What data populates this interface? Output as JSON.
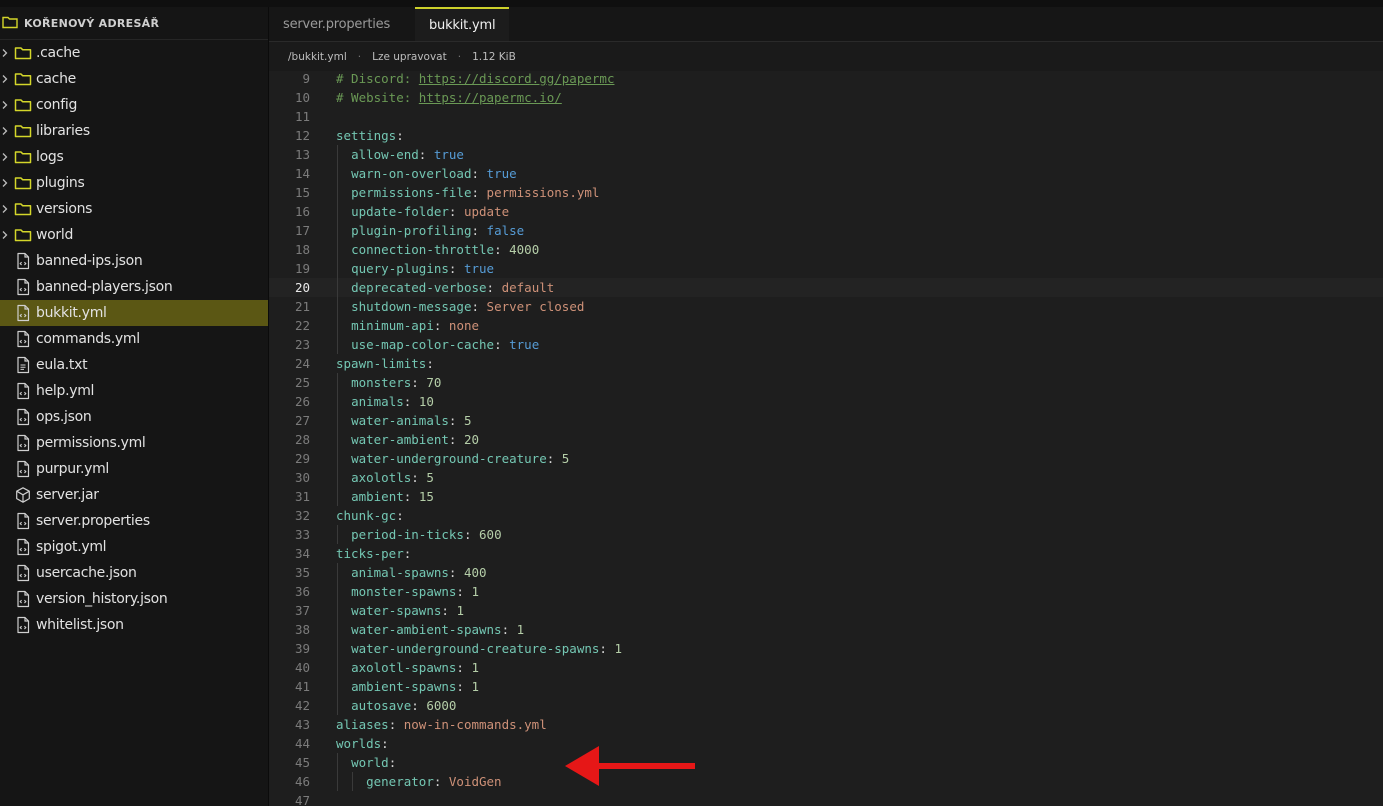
{
  "sidebar": {
    "header": "KOŘENOVÝ ADRESÁŘ",
    "items": [
      {
        "label": ".cache",
        "type": "folder"
      },
      {
        "label": "cache",
        "type": "folder"
      },
      {
        "label": "config",
        "type": "folder"
      },
      {
        "label": "libraries",
        "type": "folder"
      },
      {
        "label": "logs",
        "type": "folder"
      },
      {
        "label": "plugins",
        "type": "folder"
      },
      {
        "label": "versions",
        "type": "folder"
      },
      {
        "label": "world",
        "type": "folder"
      },
      {
        "label": "banned-ips.json",
        "type": "code-file"
      },
      {
        "label": "banned-players.json",
        "type": "code-file"
      },
      {
        "label": "bukkit.yml",
        "type": "code-file",
        "selected": true
      },
      {
        "label": "commands.yml",
        "type": "code-file"
      },
      {
        "label": "eula.txt",
        "type": "text-file"
      },
      {
        "label": "help.yml",
        "type": "code-file"
      },
      {
        "label": "ops.json",
        "type": "code-file"
      },
      {
        "label": "permissions.yml",
        "type": "code-file"
      },
      {
        "label": "purpur.yml",
        "type": "code-file"
      },
      {
        "label": "server.jar",
        "type": "package-file"
      },
      {
        "label": "server.properties",
        "type": "code-file"
      },
      {
        "label": "spigot.yml",
        "type": "code-file"
      },
      {
        "label": "usercache.json",
        "type": "code-file"
      },
      {
        "label": "version_history.json",
        "type": "code-file"
      },
      {
        "label": "whitelist.json",
        "type": "code-file"
      }
    ]
  },
  "tabs": [
    {
      "label": "server.properties",
      "active": false
    },
    {
      "label": "bukkit.yml",
      "active": true
    }
  ],
  "fileinfo": {
    "path": "/bukkit.yml",
    "mode": "Lze upravovat",
    "size": "1.12 KiB"
  },
  "editor": {
    "current_line": 20,
    "lines": [
      {
        "n": "9",
        "indent": 0,
        "parts": [
          [
            "cmt",
            "# Discord: "
          ],
          [
            "url",
            "https://discord.gg/papermc"
          ]
        ]
      },
      {
        "n": "10",
        "indent": 0,
        "parts": [
          [
            "cmt",
            "# Website: "
          ],
          [
            "url",
            "https://papermc.io/"
          ]
        ]
      },
      {
        "n": "11",
        "indent": 0,
        "parts": []
      },
      {
        "n": "12",
        "indent": 0,
        "parts": [
          [
            "key",
            "settings"
          ],
          [
            "punc",
            ":"
          ]
        ]
      },
      {
        "n": "13",
        "indent": 1,
        "parts": [
          [
            "key",
            "allow-end"
          ],
          [
            "punc",
            ": "
          ],
          [
            "bool",
            "true"
          ]
        ]
      },
      {
        "n": "14",
        "indent": 1,
        "parts": [
          [
            "key",
            "warn-on-overload"
          ],
          [
            "punc",
            ": "
          ],
          [
            "bool",
            "true"
          ]
        ]
      },
      {
        "n": "15",
        "indent": 1,
        "parts": [
          [
            "key",
            "permissions-file"
          ],
          [
            "punc",
            ": "
          ],
          [
            "str",
            "permissions.yml"
          ]
        ]
      },
      {
        "n": "16",
        "indent": 1,
        "parts": [
          [
            "key",
            "update-folder"
          ],
          [
            "punc",
            ": "
          ],
          [
            "str",
            "update"
          ]
        ]
      },
      {
        "n": "17",
        "indent": 1,
        "parts": [
          [
            "key",
            "plugin-profiling"
          ],
          [
            "punc",
            ": "
          ],
          [
            "bool",
            "false"
          ]
        ]
      },
      {
        "n": "18",
        "indent": 1,
        "parts": [
          [
            "key",
            "connection-throttle"
          ],
          [
            "punc",
            ": "
          ],
          [
            "num",
            "4000"
          ]
        ]
      },
      {
        "n": "19",
        "indent": 1,
        "parts": [
          [
            "key",
            "query-plugins"
          ],
          [
            "punc",
            ": "
          ],
          [
            "bool",
            "true"
          ]
        ]
      },
      {
        "n": "20",
        "indent": 1,
        "parts": [
          [
            "key",
            "deprecated-verbose"
          ],
          [
            "punc",
            ": "
          ],
          [
            "str",
            "default"
          ]
        ]
      },
      {
        "n": "21",
        "indent": 1,
        "parts": [
          [
            "key",
            "shutdown-message"
          ],
          [
            "punc",
            ": "
          ],
          [
            "str",
            "Server closed"
          ]
        ]
      },
      {
        "n": "22",
        "indent": 1,
        "parts": [
          [
            "key",
            "minimum-api"
          ],
          [
            "punc",
            ": "
          ],
          [
            "str",
            "none"
          ]
        ]
      },
      {
        "n": "23",
        "indent": 1,
        "parts": [
          [
            "key",
            "use-map-color-cache"
          ],
          [
            "punc",
            ": "
          ],
          [
            "bool",
            "true"
          ]
        ]
      },
      {
        "n": "24",
        "indent": 0,
        "parts": [
          [
            "key",
            "spawn-limits"
          ],
          [
            "punc",
            ":"
          ]
        ]
      },
      {
        "n": "25",
        "indent": 1,
        "parts": [
          [
            "key",
            "monsters"
          ],
          [
            "punc",
            ": "
          ],
          [
            "num",
            "70"
          ]
        ]
      },
      {
        "n": "26",
        "indent": 1,
        "parts": [
          [
            "key",
            "animals"
          ],
          [
            "punc",
            ": "
          ],
          [
            "num",
            "10"
          ]
        ]
      },
      {
        "n": "27",
        "indent": 1,
        "parts": [
          [
            "key",
            "water-animals"
          ],
          [
            "punc",
            ": "
          ],
          [
            "num",
            "5"
          ]
        ]
      },
      {
        "n": "28",
        "indent": 1,
        "parts": [
          [
            "key",
            "water-ambient"
          ],
          [
            "punc",
            ": "
          ],
          [
            "num",
            "20"
          ]
        ]
      },
      {
        "n": "29",
        "indent": 1,
        "parts": [
          [
            "key",
            "water-underground-creature"
          ],
          [
            "punc",
            ": "
          ],
          [
            "num",
            "5"
          ]
        ]
      },
      {
        "n": "30",
        "indent": 1,
        "parts": [
          [
            "key",
            "axolotls"
          ],
          [
            "punc",
            ": "
          ],
          [
            "num",
            "5"
          ]
        ]
      },
      {
        "n": "31",
        "indent": 1,
        "parts": [
          [
            "key",
            "ambient"
          ],
          [
            "punc",
            ": "
          ],
          [
            "num",
            "15"
          ]
        ]
      },
      {
        "n": "32",
        "indent": 0,
        "parts": [
          [
            "key",
            "chunk-gc"
          ],
          [
            "punc",
            ":"
          ]
        ]
      },
      {
        "n": "33",
        "indent": 1,
        "parts": [
          [
            "key",
            "period-in-ticks"
          ],
          [
            "punc",
            ": "
          ],
          [
            "num",
            "600"
          ]
        ]
      },
      {
        "n": "34",
        "indent": 0,
        "parts": [
          [
            "key",
            "ticks-per"
          ],
          [
            "punc",
            ":"
          ]
        ]
      },
      {
        "n": "35",
        "indent": 1,
        "parts": [
          [
            "key",
            "animal-spawns"
          ],
          [
            "punc",
            ": "
          ],
          [
            "num",
            "400"
          ]
        ]
      },
      {
        "n": "36",
        "indent": 1,
        "parts": [
          [
            "key",
            "monster-spawns"
          ],
          [
            "punc",
            ": "
          ],
          [
            "num",
            "1"
          ]
        ]
      },
      {
        "n": "37",
        "indent": 1,
        "parts": [
          [
            "key",
            "water-spawns"
          ],
          [
            "punc",
            ": "
          ],
          [
            "num",
            "1"
          ]
        ]
      },
      {
        "n": "38",
        "indent": 1,
        "parts": [
          [
            "key",
            "water-ambient-spawns"
          ],
          [
            "punc",
            ": "
          ],
          [
            "num",
            "1"
          ]
        ]
      },
      {
        "n": "39",
        "indent": 1,
        "parts": [
          [
            "key",
            "water-underground-creature-spawns"
          ],
          [
            "punc",
            ": "
          ],
          [
            "num",
            "1"
          ]
        ]
      },
      {
        "n": "40",
        "indent": 1,
        "parts": [
          [
            "key",
            "axolotl-spawns"
          ],
          [
            "punc",
            ": "
          ],
          [
            "num",
            "1"
          ]
        ]
      },
      {
        "n": "41",
        "indent": 1,
        "parts": [
          [
            "key",
            "ambient-spawns"
          ],
          [
            "punc",
            ": "
          ],
          [
            "num",
            "1"
          ]
        ]
      },
      {
        "n": "42",
        "indent": 1,
        "parts": [
          [
            "key",
            "autosave"
          ],
          [
            "punc",
            ": "
          ],
          [
            "num",
            "6000"
          ]
        ]
      },
      {
        "n": "43",
        "indent": 0,
        "parts": [
          [
            "key",
            "aliases"
          ],
          [
            "punc",
            ": "
          ],
          [
            "str",
            "now-in-commands.yml"
          ]
        ]
      },
      {
        "n": "44",
        "indent": 0,
        "parts": [
          [
            "key",
            "worlds"
          ],
          [
            "punc",
            ":"
          ]
        ]
      },
      {
        "n": "45",
        "indent": 1,
        "parts": [
          [
            "key",
            "world"
          ],
          [
            "punc",
            ":"
          ]
        ]
      },
      {
        "n": "46",
        "indent": 2,
        "parts": [
          [
            "key",
            "generator"
          ],
          [
            "punc",
            ": "
          ],
          [
            "str",
            "VoidGen"
          ]
        ]
      },
      {
        "n": "47",
        "indent": 0,
        "parts": []
      }
    ]
  },
  "annotation": {
    "color": "#e61717",
    "icon": "red-arrow-icon"
  },
  "colors": {
    "accent": "#cdd12b",
    "selected_bg": "#5b5714",
    "folder": "#d4d62a"
  }
}
